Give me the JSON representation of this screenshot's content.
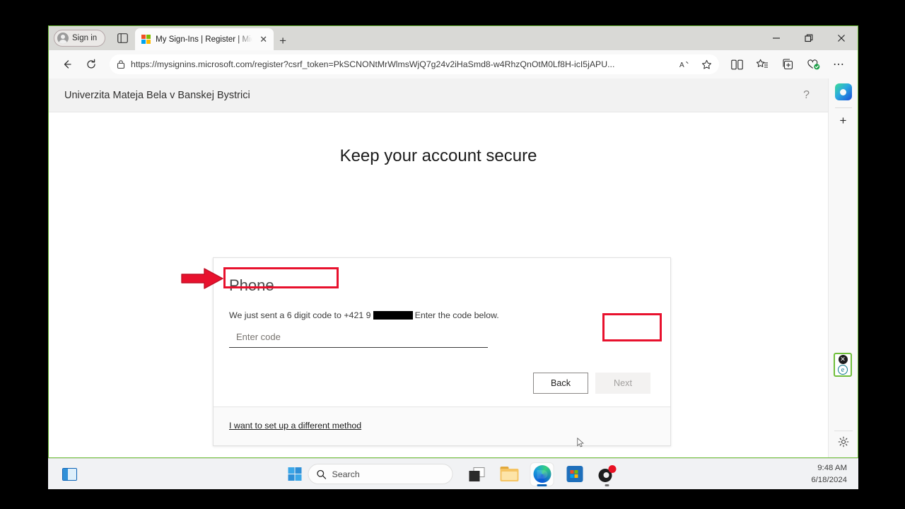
{
  "browser": {
    "signin_label": "Sign in",
    "tab": {
      "title": "My Sign-Ins | Register | Microsoft",
      "close_label": "✕",
      "favicon": "microsoft-logo-icon"
    },
    "newtab_label": "+",
    "window_controls": {
      "minimize": "—",
      "restore": "❐",
      "close": "✕"
    },
    "nav": {
      "back": "←",
      "refresh": "↻"
    },
    "address": {
      "url": "https://mysignins.microsoft.com/register?csrf_token=PkSCNONtMrWlmsWjQ7g24v2iHaSmd8-w4RhzQnOtM0Lf8H-icI5jAPU...",
      "lock_icon": "lock-icon",
      "read_aloud_icon": "A͞͞ᴴ",
      "favorite_icon": "☆"
    },
    "toolbar": {
      "split_screen": "split-screen-icon",
      "favorites": "favorites-icon",
      "collections": "collections-icon",
      "browser_essentials": "browser-essentials-icon",
      "settings_more": "⋯"
    },
    "sidebar": {
      "copilot": "copilot-icon",
      "add": "+",
      "widget_close": "✕",
      "widget_label": "e",
      "settings": "⚙"
    }
  },
  "page": {
    "org_name": "Univerzita Mateja Bela v Banskej Bystrici",
    "help_label": "?",
    "heading": "Keep your account secure",
    "card": {
      "title": "Phone",
      "sent_prefix": "We just sent a 6 digit code to +421 9",
      "sent_suffix": "Enter the code below.",
      "code_placeholder": "Enter code",
      "code_value": "",
      "back_label": "Back",
      "next_label": "Next",
      "next_disabled": true,
      "different_method_label": "I want to set up a different method"
    }
  },
  "annotations": {
    "arrow_color": "#e8112d",
    "box_color": "#e8112d",
    "highlighted": [
      "code-input",
      "next-button"
    ]
  },
  "taskbar": {
    "widgets_icon": "widgets-icon",
    "start_icon": "windows-start-icon",
    "search_placeholder": "Search",
    "search_icon": "search-icon",
    "apps": [
      {
        "name": "task-view-icon"
      },
      {
        "name": "file-explorer-icon"
      },
      {
        "name": "microsoft-edge-icon"
      },
      {
        "name": "microsoft-store-icon"
      },
      {
        "name": "obs-studio-icon"
      }
    ],
    "clock": {
      "time": "9:48 AM",
      "date": "6/18/2024"
    }
  }
}
